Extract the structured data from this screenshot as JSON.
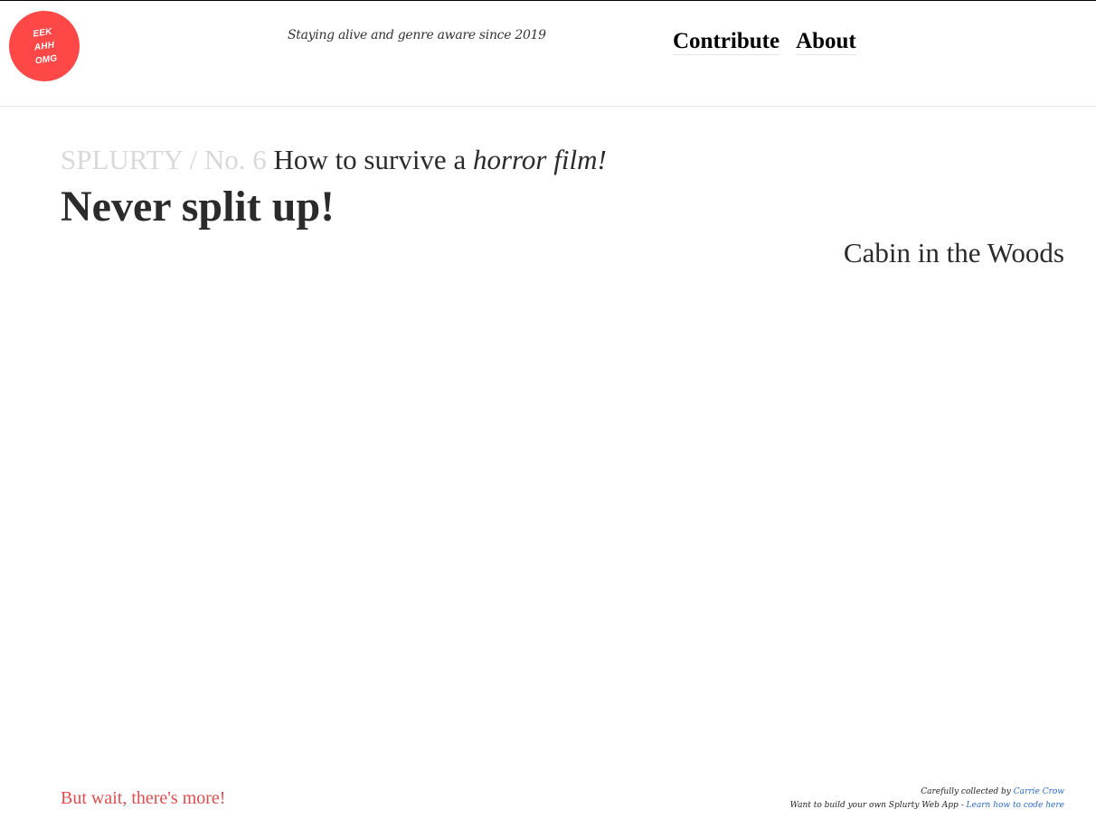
{
  "header": {
    "logo": {
      "lines": [
        "EEK",
        "AHH",
        "OMG"
      ],
      "color": "#fe4747"
    },
    "tagline": "Staying alive and genre aware since 2019",
    "nav": [
      {
        "label": "Contribute"
      },
      {
        "label": "About"
      }
    ]
  },
  "main": {
    "series_label": "SPLURTY / No. 6",
    "question_prefix": "How to survive a ",
    "question_emphasis": "horror film!",
    "rule_title": "Never split up!",
    "film": "Cabin in the Woods"
  },
  "footer": {
    "more_link": "But wait, there's more!",
    "credit_prefix": "Carefully collected by ",
    "credit_name": "Carrie Crow",
    "build_prefix": "Want to build your own Splurty Web App - ",
    "build_link": "Learn how to code here"
  },
  "colors": {
    "accent": "#fe4747",
    "link": "#2a6ccf",
    "muted": "#d9d9d9",
    "text": "#2b2b2b"
  }
}
